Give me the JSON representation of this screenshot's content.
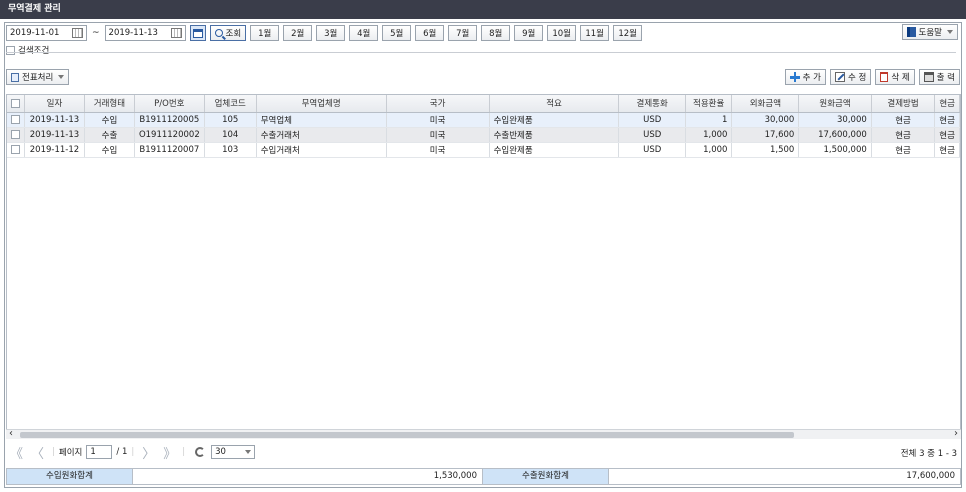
{
  "window": {
    "title": "무역결제 관리"
  },
  "toolbar": {
    "date_from": "2019-11-01",
    "tilde": "~",
    "date_to": "2019-11-13",
    "search_label": "조회",
    "months": [
      "1월",
      "2월",
      "3월",
      "4월",
      "5월",
      "6월",
      "7월",
      "8월",
      "9월",
      "10월",
      "11월",
      "12월"
    ],
    "help_label": "도움말"
  },
  "search_condition": {
    "label": "검색조건"
  },
  "actions": {
    "batch_label": "전표처리",
    "add_label": "추 가",
    "edit_label": "수 정",
    "delete_label": "삭 제",
    "print_label": "출 력"
  },
  "grid": {
    "columns": [
      "일자",
      "거래형태",
      "P/O번호",
      "업체코드",
      "무역업체명",
      "국가",
      "적요",
      "결제통화",
      "적용환율",
      "외화금액",
      "원화금액",
      "결제방법",
      "현금"
    ],
    "rows": [
      {
        "date": "2019-11-13",
        "type": "수입",
        "po": "B1911120005",
        "code": "105",
        "vendor": "무역업체",
        "country": "미국",
        "memo": "수입완제품",
        "currency": "USD",
        "rate": "1",
        "foreign": "30,000",
        "krw": "30,000",
        "method": "현금",
        "extra": "현금"
      },
      {
        "date": "2019-11-13",
        "type": "수출",
        "po": "O1911120002",
        "code": "104",
        "vendor": "수출거래처",
        "country": "미국",
        "memo": "수출반제품",
        "currency": "USD",
        "rate": "1,000",
        "foreign": "17,600",
        "krw": "17,600,000",
        "method": "현금",
        "extra": "현금"
      },
      {
        "date": "2019-11-12",
        "type": "수입",
        "po": "B1911120007",
        "code": "103",
        "vendor": "수입거래처",
        "country": "미국",
        "memo": "수입완제품",
        "currency": "USD",
        "rate": "1,000",
        "foreign": "1,500",
        "krw": "1,500,000",
        "method": "현금",
        "extra": "현금"
      }
    ]
  },
  "pager": {
    "first": "《",
    "prev": "〈",
    "page_label": "페이지",
    "page_value": "1",
    "page_total": "/ 1",
    "next": "〉",
    "last": "》",
    "page_size": "30",
    "summary": "전체 3 중 1 - 3"
  },
  "footer": {
    "import_label": "수입원화합계",
    "import_value": "1,530,000",
    "export_label": "수출원화합계",
    "export_value": "17,600,000"
  }
}
